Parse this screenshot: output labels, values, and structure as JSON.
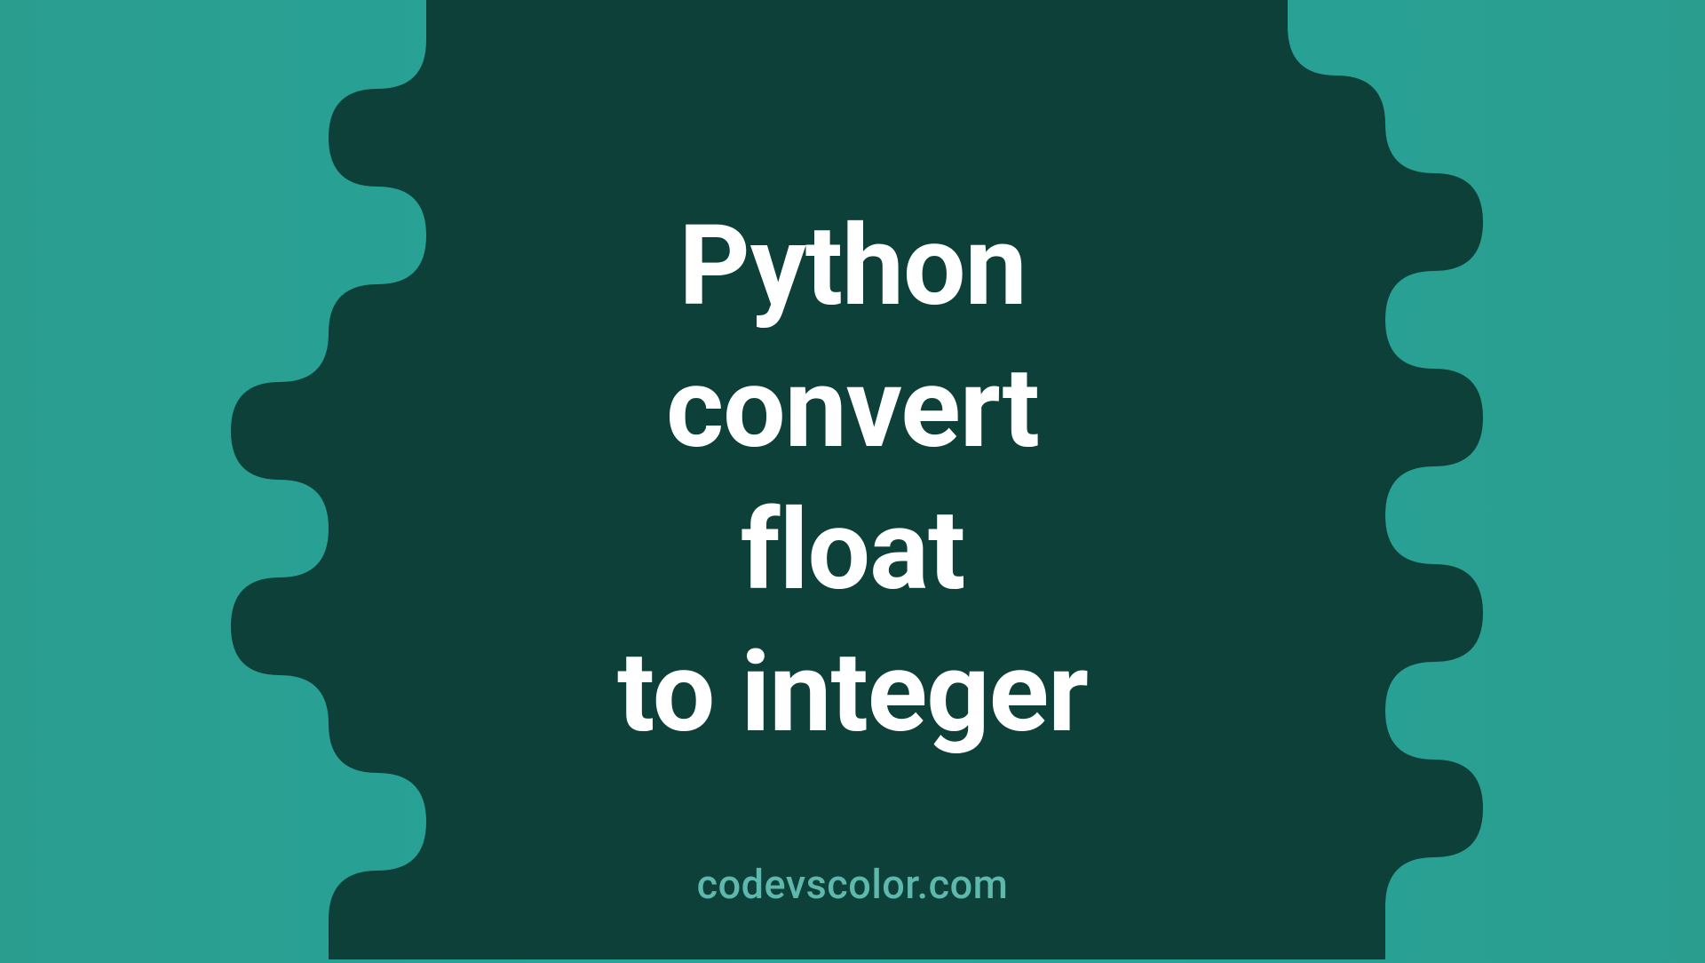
{
  "title_lines": {
    "line1": "Python",
    "line2": "convert",
    "line3": "float",
    "line4": "to integer"
  },
  "watermark": "codevscolor.com",
  "colors": {
    "background_teal": "#2a9d8f",
    "dark_teal": "#0d4038",
    "white": "#ffffff",
    "light_teal": "#5fb8ad"
  }
}
